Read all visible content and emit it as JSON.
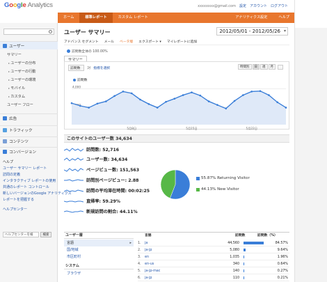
{
  "header": {
    "logo_parts": [
      "G",
      "o",
      "o",
      "g",
      "l",
      "e"
    ],
    "logo_suffix": "Analytics",
    "account": {
      "email": "xxxxxxxx@gmail.com",
      "settings": "設定",
      "my_account": "アカウント",
      "logout": "ログアウト"
    }
  },
  "nav": {
    "tabs": [
      "ホーム",
      "標準レポート",
      "カスタム レポート"
    ],
    "right_tabs": [
      "アナリティクス設定",
      "ヘルプ"
    ]
  },
  "sidebar": {
    "search_placeholder": "",
    "users_section": "ユーザー",
    "users_items": [
      "サマリー",
      "ユーザーの分布",
      "ユーザーの行動",
      "ユーザーの環境",
      "モバイル",
      "カスタム",
      "ユーザー フロー"
    ],
    "sections": [
      "広告",
      "トラフィック",
      "コンテンツ",
      "コンバージョン"
    ],
    "help_title": "ヘルプ",
    "help_links": [
      "ユーザー サマリー レポート",
      "訪問の定義",
      "インタラクティブ レポートの使用",
      "共通のレポート コントロール",
      "新しいバージョンのGoogle アナリティクス",
      "レポートを把握する"
    ],
    "help_center": "ヘルプセンター",
    "help_search_value": "ヘルプセンターを検",
    "help_search_btn": "検索"
  },
  "main": {
    "page_title": "ユーザー サマリー",
    "date_range": "2012/05/01 - 2012/05/26",
    "toolbar": [
      "アドバンス セグメント",
      "メール",
      "ベータ版",
      "エクスポート ▾",
      "マイレポートに追加"
    ],
    "visits_pct": "訪問数全体の 100.00%",
    "summary_tab": "サマリー",
    "chart_controls": {
      "metric": "訪問数",
      "vs": "対",
      "select_metric": "指標を選択"
    },
    "period_buttons": [
      "時間別",
      "日",
      "週",
      "月"
    ],
    "series_label": "訪問数",
    "y_labels": [
      "4,000",
      "2,000"
    ],
    "x_labels": [
      "5月8日",
      "5月15日",
      "5月22日"
    ],
    "users_count": "このサイトのユーザー数 34,634",
    "metrics": [
      {
        "label": "訪問数: 52,716"
      },
      {
        "label": "ユーザー数: 34,634"
      },
      {
        "label": "ページビュー数: 151,563"
      },
      {
        "label": "訪問別ページビュー: 2.88"
      },
      {
        "label": "訪問の平均滞在時間: 00:02:25"
      },
      {
        "label": "直帰率: 59.29%"
      },
      {
        "label": "新規訪問の割合: 44.11%"
      }
    ],
    "pie_legend": [
      "55.87% Returning Visitor",
      "44.13% New Visitor"
    ],
    "left_list": {
      "head1": "ユーザー層",
      "items1": [
        "言語",
        "国/地域",
        "市区町村"
      ],
      "head2": "システム",
      "items2": [
        "ブラウザ"
      ]
    },
    "table": {
      "col_name": "言語",
      "col_visits": "訪問数",
      "col_pct": "訪問数（%）",
      "rows": [
        {
          "idx": "1.",
          "name": "ja",
          "visits": "44,560",
          "pct": "84.57%"
        },
        {
          "idx": "2.",
          "name": "ja-jp",
          "visits": "5,080",
          "pct": "9.64%"
        },
        {
          "idx": "3.",
          "name": "en",
          "visits": "1,035",
          "pct": "1.96%"
        },
        {
          "idx": "4.",
          "name": "en-us",
          "visits": "340",
          "pct": "0.64%"
        },
        {
          "idx": "5.",
          "name": "ja-jp-mac",
          "visits": "140",
          "pct": "0.27%"
        },
        {
          "idx": "6.",
          "name": "ja-jp",
          "visits": "110",
          "pct": "0.21%"
        }
      ]
    }
  },
  "chart_data": {
    "type": "line",
    "series": [
      {
        "name": "訪問数",
        "values": [
          2400,
          2100,
          1900,
          2350,
          2600,
          3200,
          3700,
          3500,
          2800,
          2300,
          1900,
          2550,
          2900,
          3300,
          3600,
          3250,
          2600,
          2200,
          1800,
          2650,
          3300,
          3700,
          3750,
          3300,
          2500,
          1900
        ]
      }
    ],
    "y_ticks": [
      "4,000",
      "2,000"
    ],
    "ylim": [
      0,
      4200
    ],
    "x_labels": [
      "5月8日",
      "5月15日",
      "5月22日"
    ],
    "pie": [
      {
        "label": "Returning Visitor",
        "value": 55.87,
        "color": "#3a7ed8"
      },
      {
        "label": "New Visitor",
        "value": 44.13,
        "color": "#57b847"
      }
    ],
    "colors": {
      "line": "#3a7ed8",
      "fill": "#dfe9f8",
      "accent": "#e8762d"
    }
  }
}
